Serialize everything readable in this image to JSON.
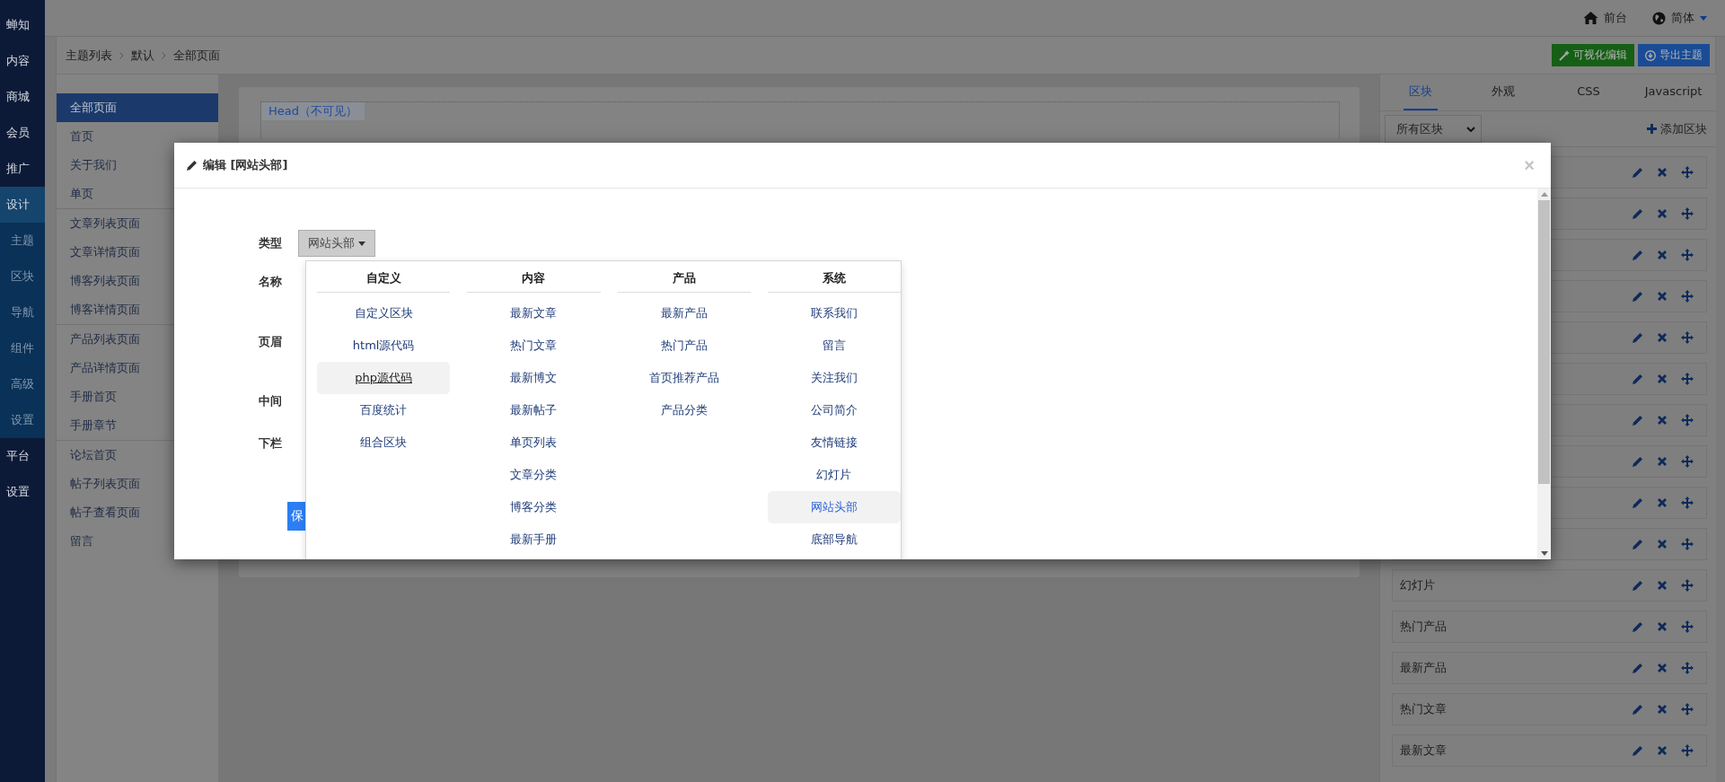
{
  "nav": [
    {
      "label": "蝉知",
      "kind": "main",
      "selected": false
    },
    {
      "label": "内容",
      "kind": "main",
      "selected": false
    },
    {
      "label": "商城",
      "kind": "main",
      "selected": false
    },
    {
      "label": "会员",
      "kind": "main",
      "selected": false
    },
    {
      "label": "推广",
      "kind": "main",
      "selected": false
    },
    {
      "label": "设计",
      "kind": "main",
      "selected": true
    },
    {
      "label": "主题",
      "kind": "sub",
      "selected": false
    },
    {
      "label": "区块",
      "kind": "sub",
      "selected": false
    },
    {
      "label": "导航",
      "kind": "sub",
      "selected": false
    },
    {
      "label": "组件",
      "kind": "sub",
      "selected": false
    },
    {
      "label": "高级",
      "kind": "sub",
      "selected": false
    },
    {
      "label": "设置",
      "kind": "sub",
      "selected": false
    },
    {
      "label": "平台",
      "kind": "main",
      "selected": false
    },
    {
      "label": "设置",
      "kind": "main",
      "selected": false
    }
  ],
  "top_bar": {
    "frontend": "前台",
    "language": "简体"
  },
  "breadcrumb": [
    "主题列表",
    "默认",
    "全部页面"
  ],
  "actions": [
    {
      "label": "可视化编辑",
      "kind": "visual"
    },
    {
      "label": "导出主题",
      "kind": "export"
    }
  ],
  "pages": [
    [
      {
        "label": "全部页面",
        "selected": true
      },
      {
        "label": "首页",
        "selected": false
      },
      {
        "label": "关于我们",
        "selected": false
      },
      {
        "label": "单页",
        "selected": false
      }
    ],
    [
      {
        "label": "文章列表页面",
        "selected": false
      },
      {
        "label": "文章详情页面",
        "selected": false
      },
      {
        "label": "博客列表页面",
        "selected": false
      },
      {
        "label": "博客详情页面",
        "selected": false
      }
    ],
    [
      {
        "label": "产品列表页面",
        "selected": false
      },
      {
        "label": "产品详情页面",
        "selected": false
      },
      {
        "label": "手册首页",
        "selected": false
      },
      {
        "label": "手册章节",
        "selected": false
      }
    ],
    [
      {
        "label": "论坛首页",
        "selected": false
      },
      {
        "label": "帖子列表页面",
        "selected": false
      },
      {
        "label": "帖子查看页面",
        "selected": false
      },
      {
        "label": "留言",
        "selected": false
      }
    ]
  ],
  "canvas": {
    "region": "Head（不可见）"
  },
  "panel": {
    "tabs": [
      {
        "label": "区块",
        "selected": true
      },
      {
        "label": "外观",
        "selected": false
      },
      {
        "label": "CSS",
        "selected": false
      },
      {
        "label": "Javascript",
        "selected": false
      }
    ],
    "filter": "所有区块",
    "add": "添加区块",
    "blocks": [
      {
        "kind": "covered"
      },
      {
        "kind": "covered"
      },
      {
        "kind": "covered"
      },
      {
        "kind": "covered"
      },
      {
        "kind": "covered"
      },
      {
        "kind": "covered"
      },
      {
        "kind": "covered"
      },
      {
        "kind": "covered"
      },
      {
        "kind": "covered"
      },
      {
        "kind": "covered"
      },
      {
        "kind": "named",
        "label": "幻灯片"
      },
      {
        "kind": "named",
        "label": "热门产品"
      },
      {
        "kind": "named",
        "label": "最新产品"
      },
      {
        "kind": "named",
        "label": "热门文章"
      },
      {
        "kind": "named",
        "label": "最新文章"
      }
    ]
  },
  "dialog": {
    "title": "编辑 [网站头部]",
    "close": "×",
    "fields": [
      "类型",
      "名称",
      "页眉",
      "中间",
      "下栏"
    ],
    "type_value": "网站头部",
    "save": "保",
    "menu": [
      {
        "header": "自定义",
        "items": [
          {
            "label": "自定义区块",
            "selected": false,
            "hovered": false
          },
          {
            "label": "html源代码",
            "selected": false,
            "hovered": false
          },
          {
            "label": "php源代码",
            "selected": false,
            "hovered": true
          },
          {
            "label": "百度统计",
            "selected": false,
            "hovered": false
          },
          {
            "label": "组合区块",
            "selected": false,
            "hovered": false
          }
        ]
      },
      {
        "header": "内容",
        "items": [
          {
            "label": "最新文章",
            "selected": false,
            "hovered": false
          },
          {
            "label": "热门文章",
            "selected": false,
            "hovered": false
          },
          {
            "label": "最新博文",
            "selected": false,
            "hovered": false
          },
          {
            "label": "最新帖子",
            "selected": false,
            "hovered": false
          },
          {
            "label": "单页列表",
            "selected": false,
            "hovered": false
          },
          {
            "label": "文章分类",
            "selected": false,
            "hovered": false
          },
          {
            "label": "博客分类",
            "selected": false,
            "hovered": false
          },
          {
            "label": "最新手册",
            "selected": false,
            "hovered": false
          }
        ]
      },
      {
        "header": "产品",
        "items": [
          {
            "label": "最新产品",
            "selected": false,
            "hovered": false
          },
          {
            "label": "热门产品",
            "selected": false,
            "hovered": false
          },
          {
            "label": "首页推荐产品",
            "selected": false,
            "hovered": false
          },
          {
            "label": "产品分类",
            "selected": false,
            "hovered": false
          }
        ]
      },
      {
        "header": "系统",
        "items": [
          {
            "label": "联系我们",
            "selected": false,
            "hovered": false
          },
          {
            "label": "留言",
            "selected": false,
            "hovered": false
          },
          {
            "label": "关注我们",
            "selected": false,
            "hovered": false
          },
          {
            "label": "公司简介",
            "selected": false,
            "hovered": false
          },
          {
            "label": "友情链接",
            "selected": false,
            "hovered": false
          },
          {
            "label": "幻灯片",
            "selected": false,
            "hovered": false
          },
          {
            "label": "网站头部",
            "selected": true,
            "hovered": false
          },
          {
            "label": "底部导航",
            "selected": false,
            "hovered": false
          }
        ]
      }
    ]
  }
}
